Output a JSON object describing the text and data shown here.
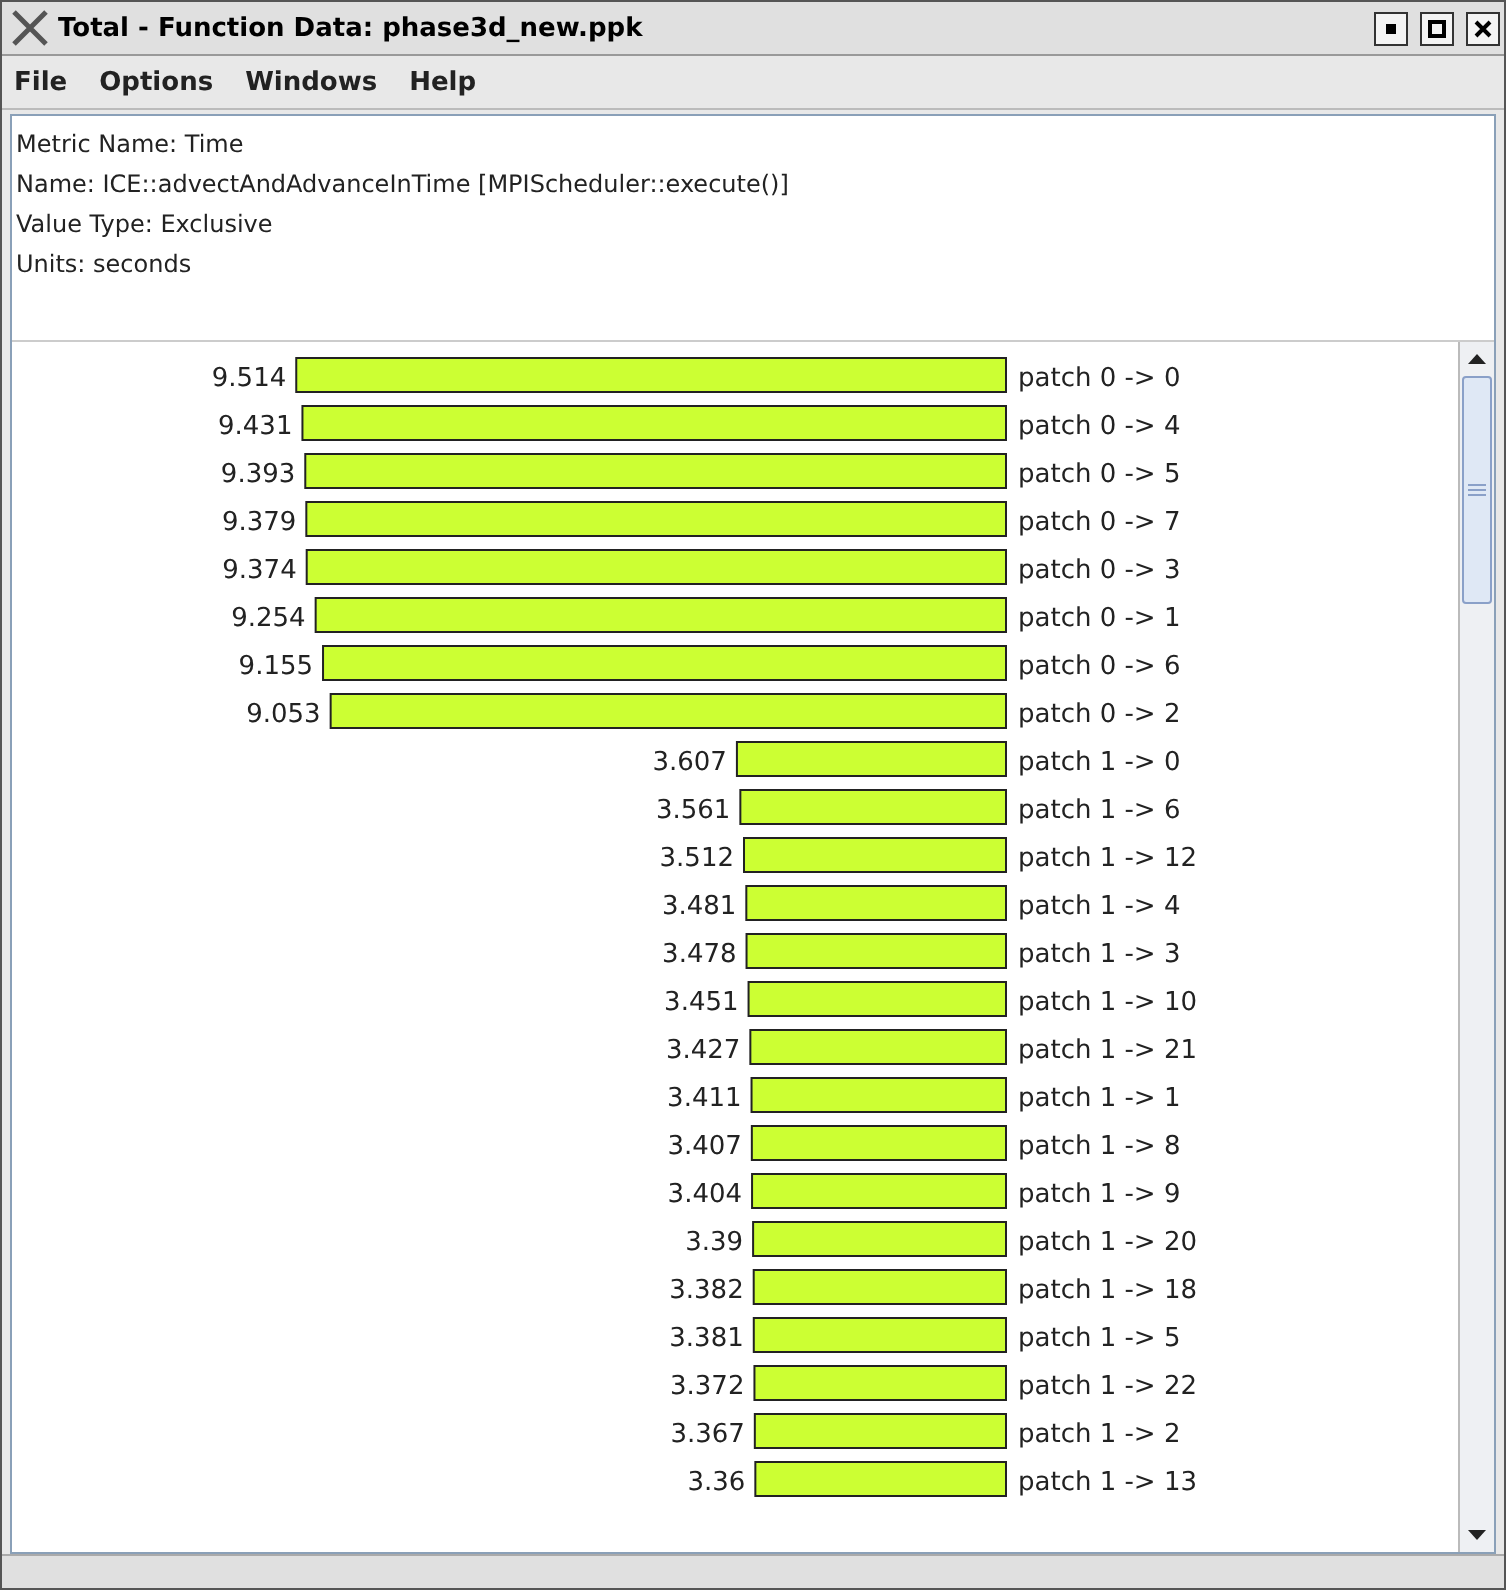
{
  "window": {
    "title": "Total - Function Data: phase3d_new.ppk"
  },
  "menu": [
    "File",
    "Options",
    "Windows",
    "Help"
  ],
  "header": [
    "Metric Name: Time",
    "Name: ICE::advectAndAdvanceInTime [MPIScheduler::execute()]",
    "Value Type: Exclusive",
    "Units: seconds"
  ],
  "chart_data": {
    "type": "bar",
    "orientation": "horizontal",
    "data_labels": true,
    "categories": [
      "patch 0 -> 0",
      "patch 0 -> 4",
      "patch 0 -> 5",
      "patch 0 -> 7",
      "patch 0 -> 3",
      "patch 0 -> 1",
      "patch 0 -> 6",
      "patch 0 -> 2",
      "patch 1 -> 0",
      "patch 1 -> 6",
      "patch 1 -> 12",
      "patch 1 -> 4",
      "patch 1 -> 3",
      "patch 1 -> 10",
      "patch 1 -> 21",
      "patch 1 -> 1",
      "patch 1 -> 8",
      "patch 1 -> 9",
      "patch 1 -> 20",
      "patch 1 -> 18",
      "patch 1 -> 5",
      "patch 1 -> 22",
      "patch 1 -> 2",
      "patch 1 -> 13"
    ],
    "values": [
      9.514,
      9.431,
      9.393,
      9.379,
      9.374,
      9.254,
      9.155,
      9.053,
      3.607,
      3.561,
      3.512,
      3.481,
      3.478,
      3.451,
      3.427,
      3.411,
      3.407,
      3.404,
      3.39,
      3.382,
      3.381,
      3.372,
      3.367,
      3.36
    ]
  }
}
